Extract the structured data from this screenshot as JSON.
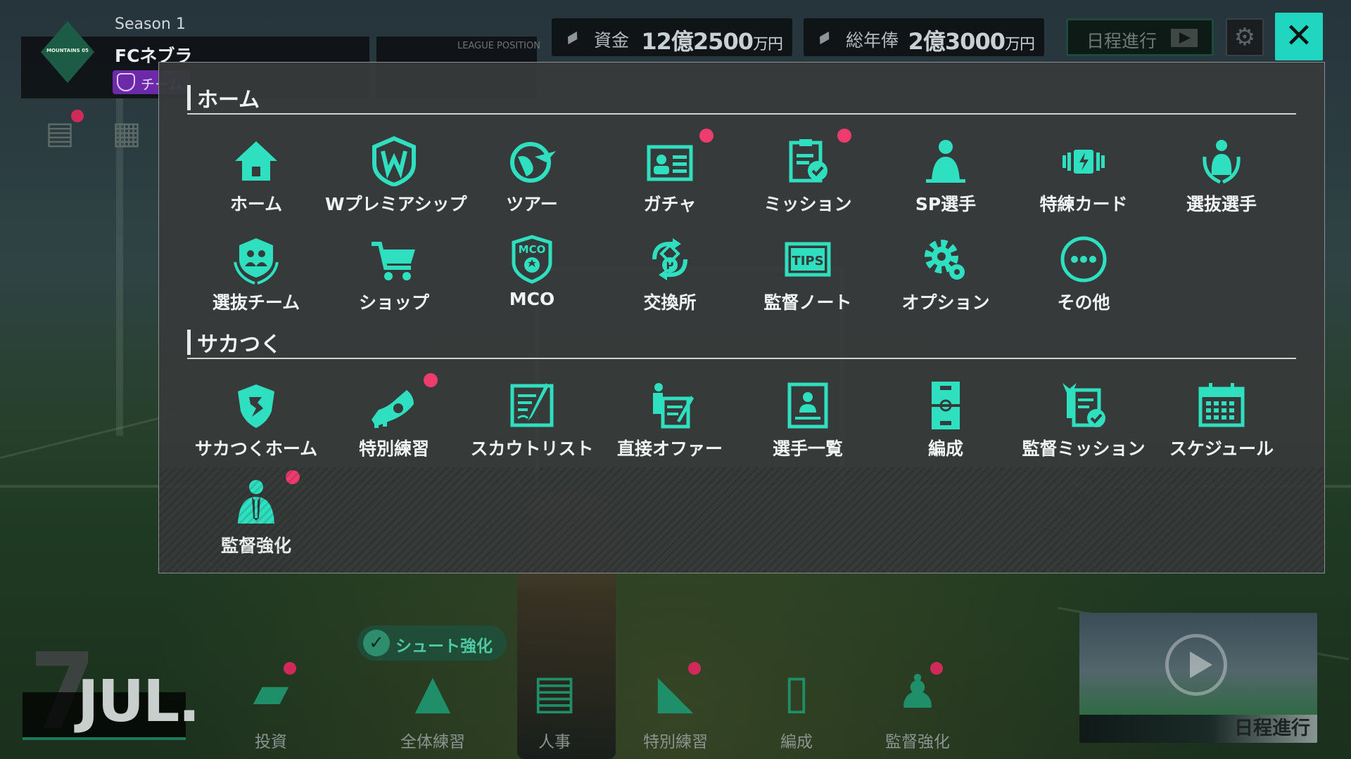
{
  "header": {
    "season": "Season 1",
    "team_name": "FCネブラ",
    "team_badge": "チーム",
    "league_label": "LEAGUE POSITION",
    "funds_label": "資金",
    "funds_value_main": "12億2500",
    "funds_value_unit": "万円",
    "salary_label": "総年俸",
    "salary_value_main": "2億3000",
    "salary_value_unit": "万円",
    "advance_label": "日程進行",
    "logo_text": "MOUNTAINS 05"
  },
  "menu": {
    "home_section": {
      "title": "ホーム",
      "items": [
        {
          "label": "ホーム",
          "icon": "home-icon",
          "badge": false
        },
        {
          "label": "Wプレミアシップ",
          "icon": "w-shield-icon",
          "badge": false
        },
        {
          "label": "ツアー",
          "icon": "globe-plane-icon",
          "badge": false
        },
        {
          "label": "ガチャ",
          "icon": "player-card-icon",
          "badge": true
        },
        {
          "label": "ミッション",
          "icon": "mission-clipboard-icon",
          "badge": true
        },
        {
          "label": "SP選手",
          "icon": "sp-player-icon",
          "badge": false
        },
        {
          "label": "特練カード",
          "icon": "training-card-icon",
          "badge": false
        },
        {
          "label": "選抜選手",
          "icon": "selected-player-icon",
          "badge": false
        },
        {
          "label": "選抜チーム",
          "icon": "selected-team-icon",
          "badge": false
        },
        {
          "label": "ショップ",
          "icon": "cart-icon",
          "badge": false
        },
        {
          "label": "MCO",
          "icon": "mco-shield-icon",
          "badge": false
        },
        {
          "label": "交換所",
          "icon": "exchange-icon",
          "badge": false
        },
        {
          "label": "監督ノート",
          "icon": "tips-icon",
          "badge": false
        },
        {
          "label": "オプション",
          "icon": "gear-icon",
          "badge": false
        },
        {
          "label": "その他",
          "icon": "more-icon",
          "badge": false
        }
      ]
    },
    "sakatsuku_section": {
      "title": "サカつく",
      "items": [
        {
          "label": "サカつくホーム",
          "icon": "sakatsuku-home-icon",
          "badge": false
        },
        {
          "label": "特別練習",
          "icon": "boot-icon",
          "badge": true
        },
        {
          "label": "スカウトリスト",
          "icon": "scout-list-icon",
          "badge": false
        },
        {
          "label": "直接オファー",
          "icon": "direct-offer-icon",
          "badge": false
        },
        {
          "label": "選手一覧",
          "icon": "player-list-icon",
          "badge": false
        },
        {
          "label": "編成",
          "icon": "formation-icon",
          "badge": false
        },
        {
          "label": "監督ミッション",
          "icon": "manager-mission-icon",
          "badge": false
        },
        {
          "label": "スケジュール",
          "icon": "calendar-icon",
          "badge": false
        },
        {
          "label": "監督強化",
          "icon": "manager-icon",
          "badge": true
        }
      ]
    }
  },
  "bottom": {
    "day": "7",
    "month": "JUL.",
    "shoot_chip": "シュート強化",
    "items": [
      {
        "label": "投資",
        "icon": "money-stack-icon",
        "badge": true
      },
      {
        "label": "全体練習",
        "icon": "ball-cone-icon",
        "badge": false
      },
      {
        "label": "人事",
        "icon": "document-pen-icon",
        "badge": false
      },
      {
        "label": "特別練習",
        "icon": "boot-icon",
        "badge": true
      },
      {
        "label": "編成",
        "icon": "formation-icon",
        "badge": false
      },
      {
        "label": "監督強化",
        "icon": "manager-icon",
        "badge": true
      }
    ],
    "video_label": "日程進行"
  },
  "colors": {
    "accent": "#2ee0c0",
    "close_button": "#20d6c0",
    "notification": "#ef3c6e"
  }
}
